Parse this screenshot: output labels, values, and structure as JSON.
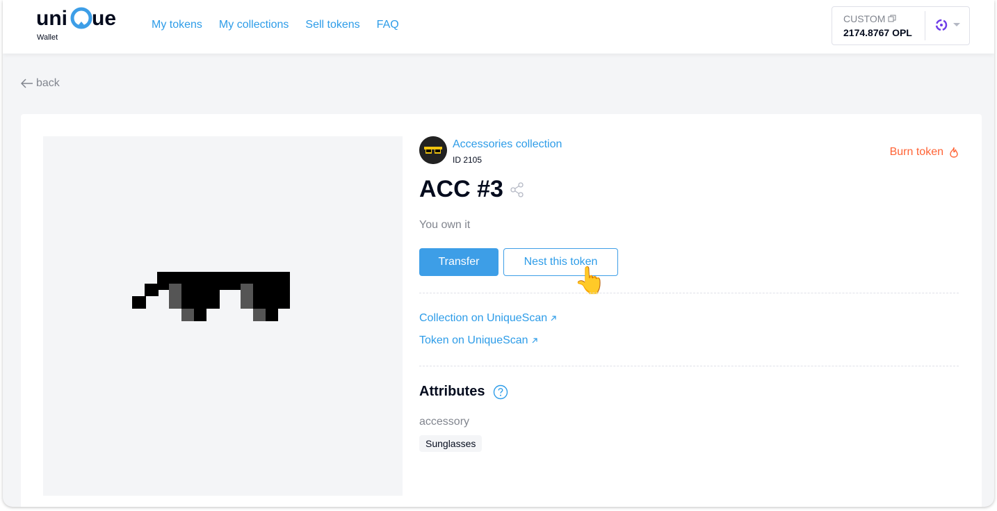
{
  "brand": {
    "name": "unique",
    "subtitle": "Wallet"
  },
  "nav": {
    "items": [
      "My tokens",
      "My collections",
      "Sell tokens",
      "FAQ"
    ]
  },
  "account": {
    "name": "CUSTOM",
    "balance": "2174.8767 OPL",
    "network_icon": "polkadot-network-icon",
    "dropdown_icon": "chevron-down-icon"
  },
  "back_label": "back",
  "token": {
    "collection_name": "Accessories collection",
    "collection_id": "ID 2105",
    "title": "ACC #3",
    "ownership": "You own it",
    "burn_label": "Burn token",
    "transfer_label": "Transfer",
    "nest_label": "Nest this token"
  },
  "links": {
    "collection_scan": "Collection on UniqueScan",
    "token_scan": "Token on UniqueScan"
  },
  "attributes": {
    "heading": "Attributes",
    "items": [
      {
        "name": "accessory",
        "value": "Sunglasses"
      }
    ]
  },
  "colors": {
    "accent": "#2d9ce8",
    "primary_button": "#3d9ee7",
    "danger": "#ff6335",
    "muted_text": "#81858e"
  }
}
